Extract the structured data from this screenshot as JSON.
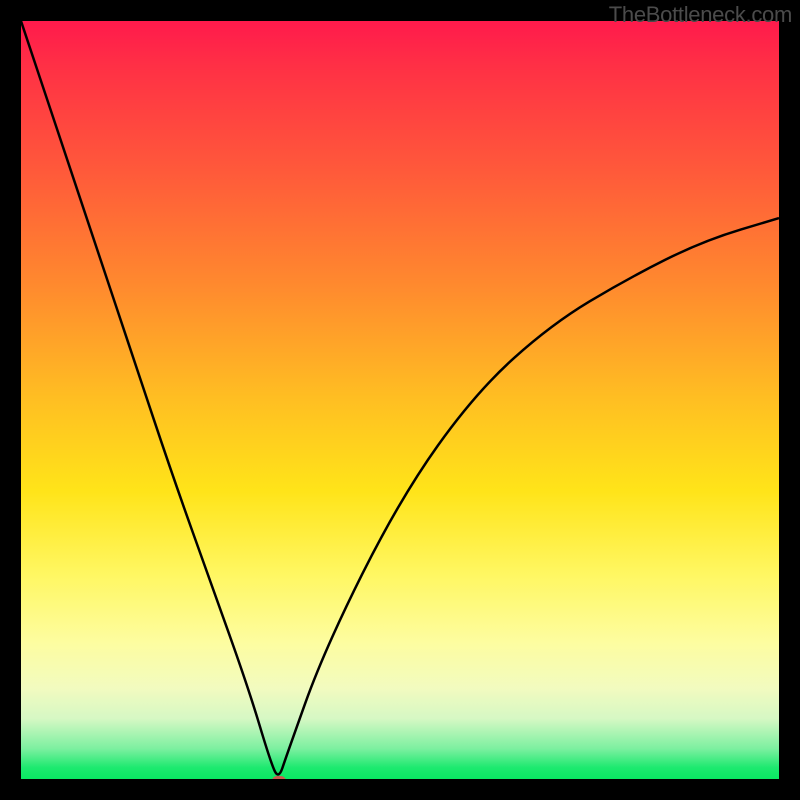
{
  "watermark": "TheBottleneck.com",
  "chart_data": {
    "type": "line",
    "title": "",
    "xlabel": "",
    "ylabel": "",
    "ylim": [
      0,
      100
    ],
    "xlim": [
      0,
      100
    ],
    "series": [
      {
        "name": "curve",
        "x": [
          0,
          5,
          10,
          15,
          20,
          25,
          30,
          33,
          34,
          35,
          40,
          50,
          60,
          70,
          80,
          90,
          100
        ],
        "values": [
          100,
          85,
          70,
          55,
          40,
          26,
          12,
          2,
          0,
          3,
          17,
          37,
          51,
          60,
          66,
          71,
          74
        ]
      }
    ],
    "marker": {
      "x": 34,
      "y": 0
    },
    "colors": {
      "curve": "#000000",
      "marker": "#c85a4e"
    }
  }
}
